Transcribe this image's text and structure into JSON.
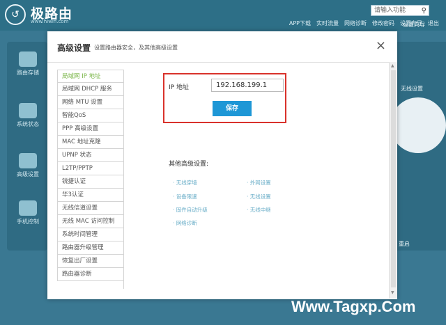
{
  "header": {
    "logo_glyph": "↺",
    "logo_text": "极路由",
    "logo_sub": "www.hiwifi.com",
    "search_placeholder": "请输入功能",
    "nav": [
      "APP下载",
      "实时流量",
      "网络诊断",
      "修改密码",
      "设置向导",
      "退出"
    ]
  },
  "left_panel": {
    "items": [
      "路由存储",
      "系统状态",
      "高级设置",
      "手机控制"
    ]
  },
  "right_panel": {
    "wifi_label": "无线设置",
    "items": [
      "设置向导",
      "重启"
    ]
  },
  "modal": {
    "title": "高级设置",
    "subtitle": "设置路由器安全，及其他高级设置",
    "close": "×",
    "menu": [
      "局域网 IP 地址",
      "局域网 DHCP 服务",
      "网络 MTU 设置",
      "智能QoS",
      "PPP 高级设置",
      "MAC 地址克隆",
      "UPNP 状态",
      "L2TP/PPTP",
      "锐捷认证",
      "华3认证",
      "无线信道设置",
      "无线 MAC 访问控制",
      "系统时间管理",
      "路由器升级管理",
      "恢复出厂设置",
      "路由器诊断"
    ],
    "ip_label": "IP 地址",
    "ip_value": "192.168.199.1",
    "save_label": "保存",
    "other_title": "其他高级设置:",
    "other_links": [
      "· 无线穿墙",
      "· 外网设置",
      "· 设备限速",
      "· 无线设置",
      "· 固件自动升级",
      "· 无线中继",
      "· 网络诊断"
    ]
  },
  "watermark": "Www.Tagxp.Com"
}
